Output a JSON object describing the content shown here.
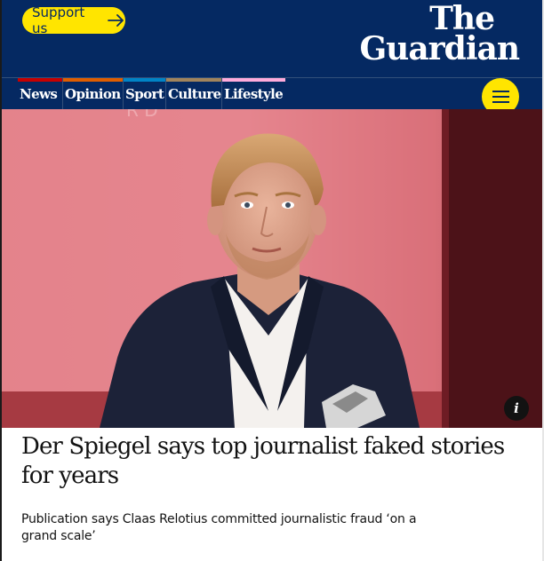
{
  "masthead": {
    "support_label": "Support us",
    "logo_line1": "The",
    "logo_line2": "Guardian",
    "brand_color": "#052962",
    "accent_color": "#ffe500"
  },
  "nav": {
    "items": [
      {
        "label": "News",
        "color": "#c70000"
      },
      {
        "label": "Opinion",
        "color": "#e05e00"
      },
      {
        "label": "Sport",
        "color": "#0084c6"
      },
      {
        "label": "Culture",
        "color": "#a1845c"
      },
      {
        "label": "Lifestyle",
        "color": "#ffabdb"
      }
    ],
    "menu_icon": "hamburger-menu-icon"
  },
  "article": {
    "info_label": "i",
    "headline": "Der Spiegel says top journalist faked stories for years",
    "standfirst": "Publication says Claas Relotius committed journalistic fraud ‘on a grand scale’"
  }
}
